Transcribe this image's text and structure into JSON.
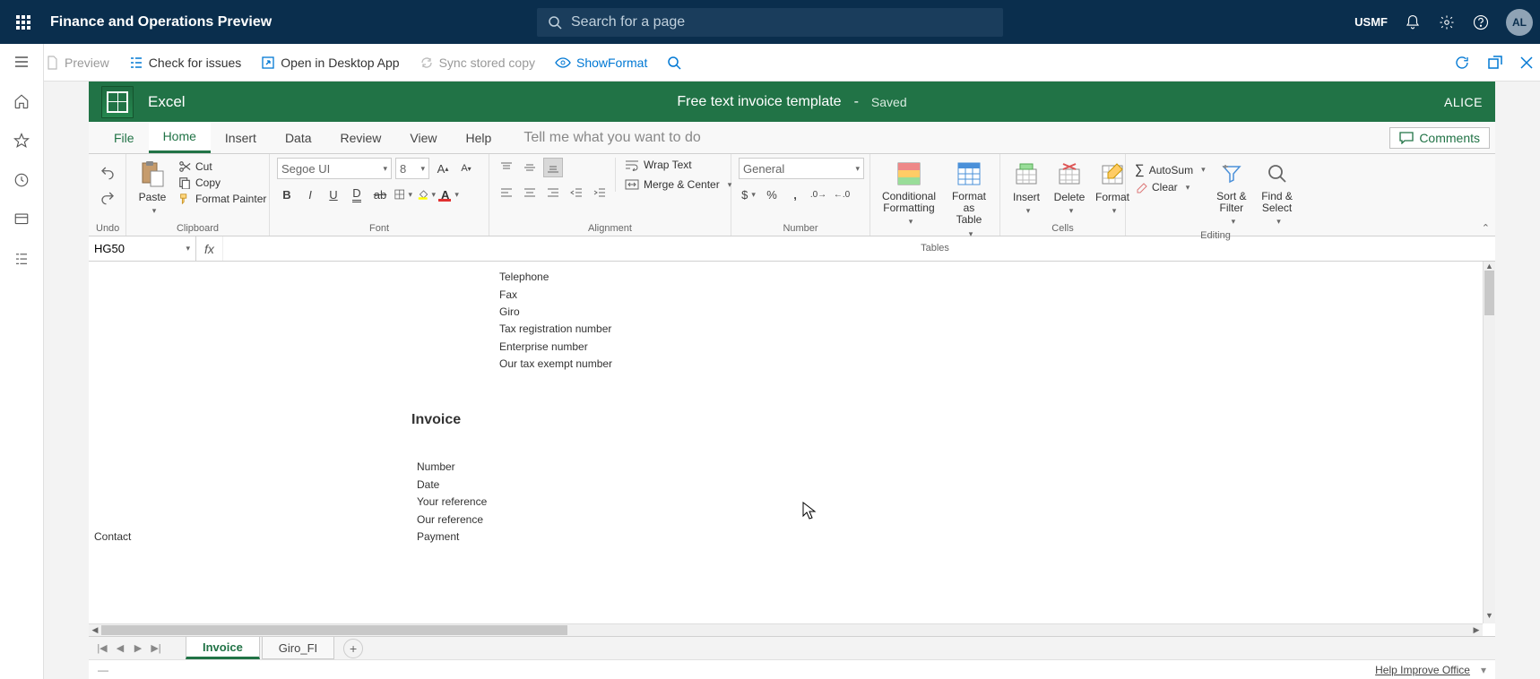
{
  "header": {
    "title": "Finance and Operations Preview",
    "search_placeholder": "Search for a page",
    "company": "USMF",
    "avatar": "AL"
  },
  "toolbar": {
    "preview": "Preview",
    "check_issues": "Check for issues",
    "open_desktop": "Open in Desktop App",
    "sync": "Sync stored copy",
    "show_format": "ShowFormat"
  },
  "excel": {
    "app_name": "Excel",
    "doc_title": "Free text invoice template",
    "saved": "Saved",
    "user": "ALICE"
  },
  "tabs": {
    "file": "File",
    "home": "Home",
    "insert": "Insert",
    "data": "Data",
    "review": "Review",
    "view": "View",
    "help": "Help",
    "tellme": "Tell me what you want to do",
    "comments": "Comments"
  },
  "ribbon": {
    "undo": "Undo",
    "paste": "Paste",
    "cut": "Cut",
    "copy": "Copy",
    "format_painter": "Format Painter",
    "clipboard": "Clipboard",
    "font_name": "Segoe UI",
    "font_size": "8",
    "font": "Font",
    "wrap_text": "Wrap Text",
    "merge_center": "Merge & Center",
    "alignment": "Alignment",
    "number_format": "General",
    "number": "Number",
    "cond_format": "Conditional Formatting",
    "format_table": "Format as Table",
    "tables": "Tables",
    "insert": "Insert",
    "delete": "Delete",
    "format": "Format",
    "cells": "Cells",
    "autosum": "AutoSum",
    "clear": "Clear",
    "sort_filter": "Sort & Filter",
    "find_select": "Find & Select",
    "editing": "Editing"
  },
  "namebox": "HG50",
  "cells": {
    "telephone": "Telephone",
    "fax": "Fax",
    "giro": "Giro",
    "tax_reg": "Tax registration number",
    "enterprise_no": "Enterprise number",
    "our_tax_exempt": "Our tax exempt number",
    "invoice_heading": "Invoice",
    "number": "Number",
    "date": "Date",
    "your_ref": "Your reference",
    "our_ref": "Our reference",
    "payment": "Payment",
    "contact": "Contact"
  },
  "sheets": {
    "invoice": "Invoice",
    "giro_fi": "Giro_FI"
  },
  "status": {
    "help": "Help Improve Office"
  }
}
